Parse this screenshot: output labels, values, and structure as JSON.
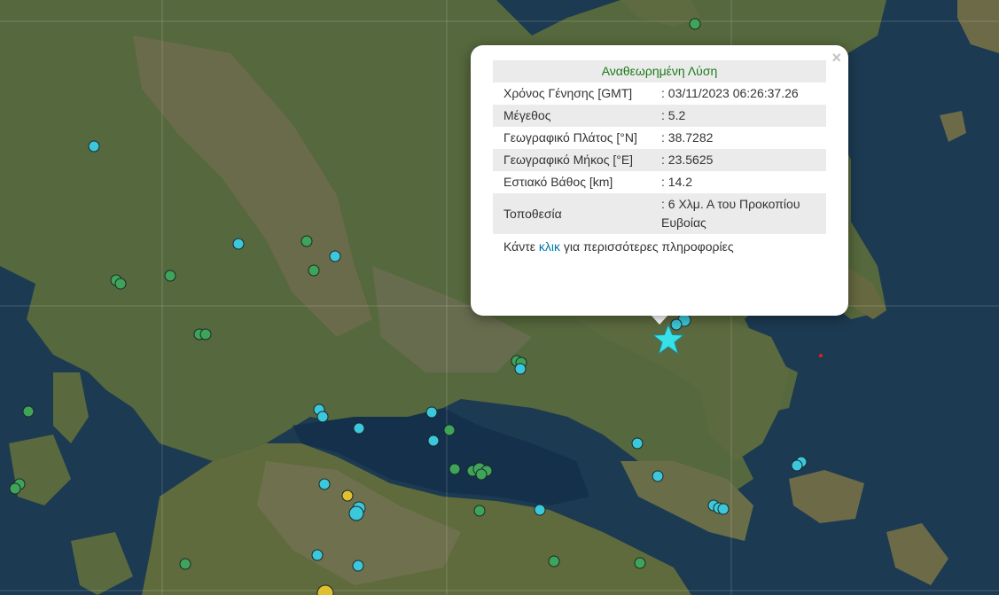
{
  "popup": {
    "title": "Αναθεωρημένη Λύση",
    "close_label": "×",
    "rows": [
      {
        "label": "Χρόνος Γένησης [GMT]",
        "value": ": 03/11/2023 06:26:37.26"
      },
      {
        "label": "Μέγεθος",
        "value": ": 5.2"
      },
      {
        "label": "Γεωγραφικό Πλάτος [°N]",
        "value": ": 38.7282"
      },
      {
        "label": "Γεωγραφικό Μήκος [°E]",
        "value": ": 23.5625"
      },
      {
        "label": "Εστιακό Βάθος [km]",
        "value": ": 14.2"
      },
      {
        "label": "Τοποθεσία",
        "value": ": 6 Χλμ. Α του Προκοπίου Ευβοίας"
      }
    ],
    "footer_pre": "Κάντε ",
    "footer_link": "κλικ",
    "footer_post": " για περισσότερες πληροφορίες"
  },
  "colors": {
    "sea": "#1c3a52",
    "land": "#5a6b3e",
    "mountain": "#7a7456",
    "marker_cyan": "#3cc8dc",
    "marker_green": "#3fa45a",
    "marker_yellow": "#e0c030",
    "epicenter": "#38e0e8",
    "title_green": "#1b7a1b",
    "link_blue": "#0078a8"
  },
  "markers": {
    "epicenter_icon": "star-icon",
    "event_icon": "circle-icon"
  }
}
